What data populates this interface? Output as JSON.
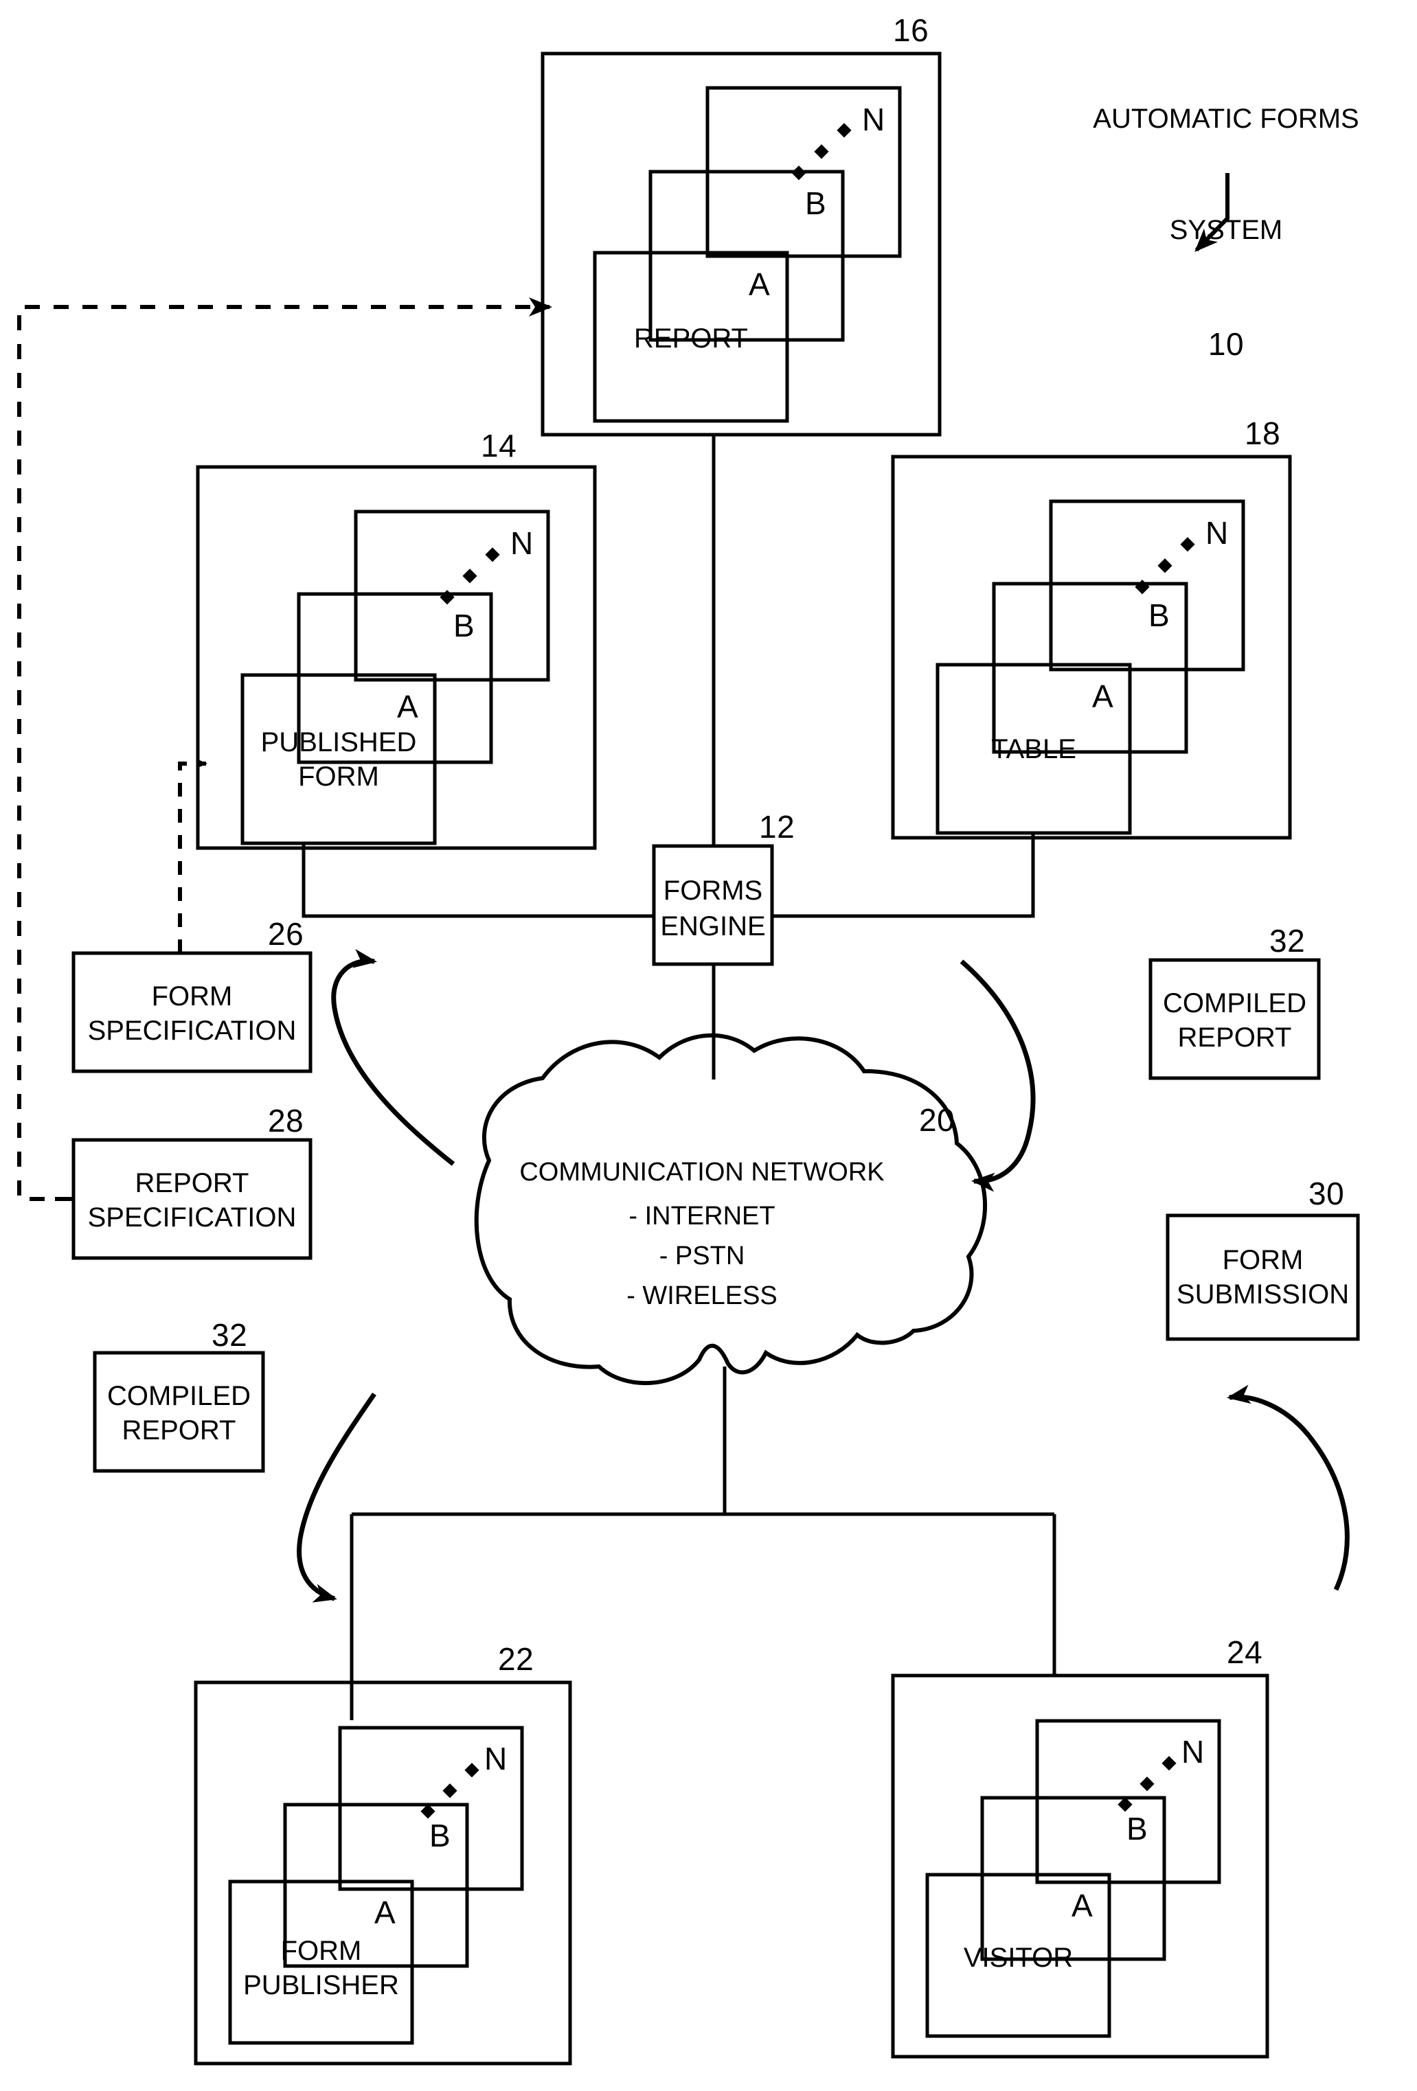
{
  "figure": {
    "title_lines": [
      "AUTOMATIC FORMS",
      "SYSTEM"
    ],
    "title_ref": "10"
  },
  "groups": {
    "report": {
      "ref": "16",
      "card_label": "REPORT",
      "letters": {
        "front": "A",
        "middle": "B",
        "back": "N"
      }
    },
    "published_form": {
      "ref": "14",
      "card_label_line1": "PUBLISHED",
      "card_label_line2": "FORM",
      "letters": {
        "front": "A",
        "middle": "B",
        "back": "N"
      }
    },
    "table": {
      "ref": "18",
      "card_label": "TABLE",
      "letters": {
        "front": "A",
        "middle": "B",
        "back": "N"
      }
    },
    "form_publisher": {
      "ref": "22",
      "card_label_line1": "FORM",
      "card_label_line2": "PUBLISHER",
      "letters": {
        "front": "A",
        "middle": "B",
        "back": "N"
      }
    },
    "visitor": {
      "ref": "24",
      "card_label": "VISITOR",
      "letters": {
        "front": "A",
        "middle": "B",
        "back": "N"
      }
    }
  },
  "boxes": {
    "forms_engine": {
      "ref": "12",
      "line1": "FORMS",
      "line2": "ENGINE"
    },
    "form_specification": {
      "ref": "26",
      "line1": "FORM",
      "line2": "SPECIFICATION"
    },
    "report_specification": {
      "ref": "28",
      "line1": "REPORT",
      "line2": "SPECIFICATION"
    },
    "compiled_report_right": {
      "ref": "32",
      "line1": "COMPILED",
      "line2": "REPORT"
    },
    "compiled_report_left": {
      "ref": "32",
      "line1": "COMPILED",
      "line2": "REPORT"
    },
    "form_submission": {
      "ref": "30",
      "line1": "FORM",
      "line2": "SUBMISSION"
    }
  },
  "cloud": {
    "ref": "20",
    "title": "COMMUNICATION NETWORK",
    "items": [
      "- INTERNET",
      "- PSTN",
      "- WIRELESS"
    ]
  },
  "style": {
    "ink": "#000000",
    "paper": "#ffffff"
  }
}
